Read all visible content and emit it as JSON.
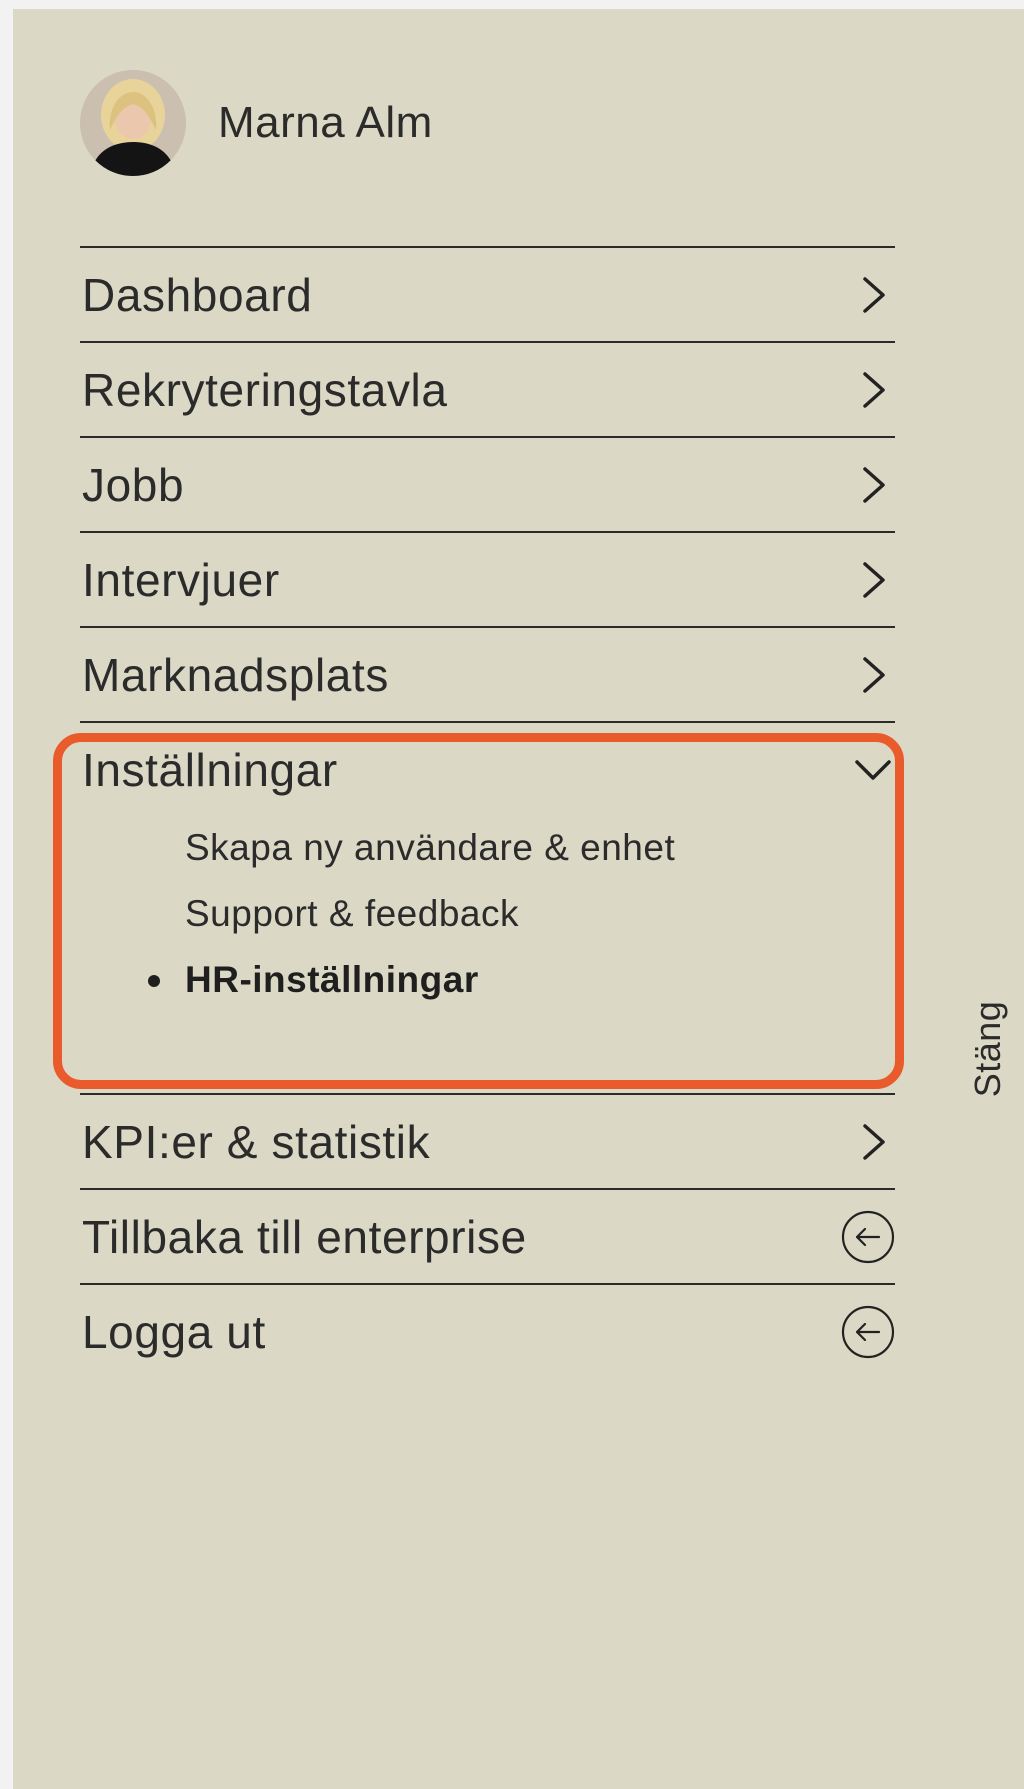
{
  "user": {
    "name": "Marna Alm"
  },
  "nav": {
    "items": [
      {
        "label": "Dashboard",
        "icon": "chevron-right-icon"
      },
      {
        "label": "Rekryteringstavla",
        "icon": "chevron-right-icon"
      },
      {
        "label": "Jobb",
        "icon": "chevron-right-icon"
      },
      {
        "label": "Intervjuer",
        "icon": "chevron-right-icon"
      },
      {
        "label": "Marknadsplats",
        "icon": "chevron-right-icon"
      }
    ],
    "settings": {
      "label": "Inställningar",
      "icon": "chevron-down-icon",
      "subitems": [
        {
          "label": "Skapa ny användare & enhet"
        },
        {
          "label": "Support & feedback"
        },
        {
          "label": "HR-inställningar",
          "active": true
        }
      ]
    },
    "after_items": [
      {
        "label": "KPI:er & statistik",
        "icon": "chevron-right-icon"
      },
      {
        "label": "Tillbaka till enterprise",
        "icon": "arrow-left-circle-icon"
      },
      {
        "label": "Logga ut",
        "icon": "arrow-left-circle-icon"
      }
    ]
  },
  "close_label": "Stäng",
  "colors": {
    "panel_bg": "#dbd8c5",
    "page_bg": "#f2f2f2",
    "text": "#2b2b2b",
    "highlight": "#ea5b2b"
  }
}
